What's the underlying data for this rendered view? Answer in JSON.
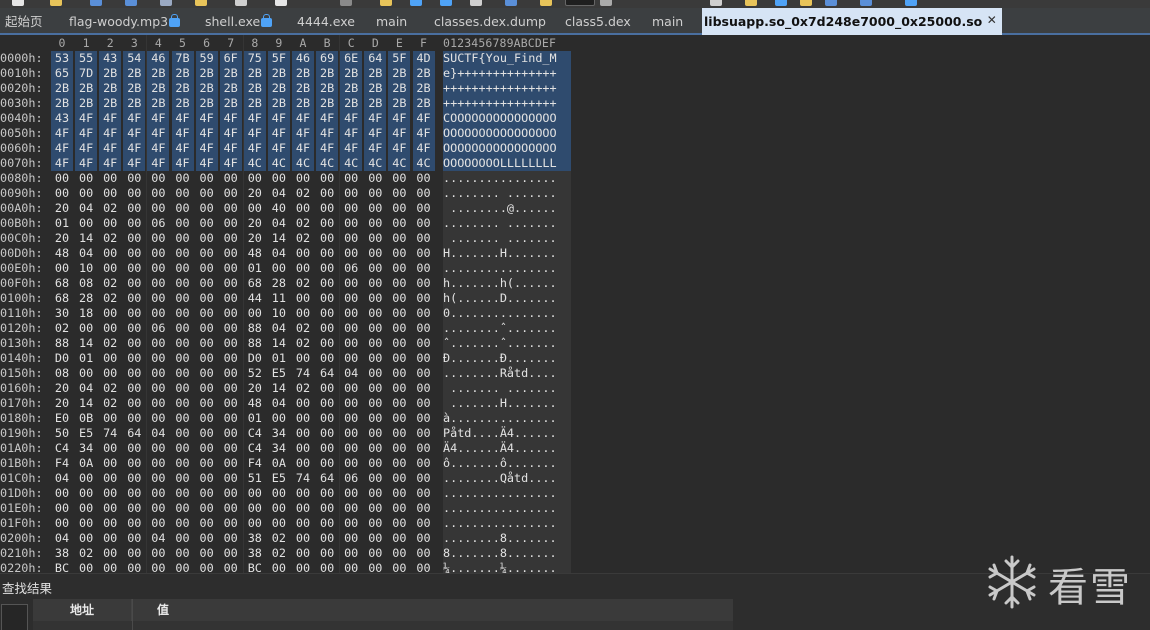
{
  "tabs": [
    {
      "label": "起始页",
      "locked": false,
      "active": false
    },
    {
      "label": "flag-woody.mp3",
      "locked": true,
      "active": false
    },
    {
      "label": "shell.exe",
      "locked": true,
      "active": false
    },
    {
      "label": "4444.exe",
      "locked": false,
      "active": false
    },
    {
      "label": "main",
      "locked": false,
      "active": false
    },
    {
      "label": "classes.dex.dump",
      "locked": false,
      "active": false
    },
    {
      "label": "class5.dex",
      "locked": false,
      "active": false
    },
    {
      "label": "main",
      "locked": false,
      "active": false
    },
    {
      "label": "libsuapp.so_0x7d248e7000_0x25000.so",
      "locked": false,
      "active": true
    }
  ],
  "hex_view": {
    "column_headers": [
      "0",
      "1",
      "2",
      "3",
      "4",
      "5",
      "6",
      "7",
      "8",
      "9",
      "A",
      "B",
      "C",
      "D",
      "E",
      "F"
    ],
    "ascii_header": "0123456789ABCDEF",
    "rows": [
      {
        "offset": "0000h:",
        "bytes": [
          "53",
          "55",
          "43",
          "54",
          "46",
          "7B",
          "59",
          "6F",
          "75",
          "5F",
          "46",
          "69",
          "6E",
          "64",
          "5F",
          "4D"
        ],
        "ascii": "SUCTF{You_Find_M",
        "selected": true
      },
      {
        "offset": "0010h:",
        "bytes": [
          "65",
          "7D",
          "2B",
          "2B",
          "2B",
          "2B",
          "2B",
          "2B",
          "2B",
          "2B",
          "2B",
          "2B",
          "2B",
          "2B",
          "2B",
          "2B"
        ],
        "ascii": "e}++++++++++++++",
        "selected": true
      },
      {
        "offset": "0020h:",
        "bytes": [
          "2B",
          "2B",
          "2B",
          "2B",
          "2B",
          "2B",
          "2B",
          "2B",
          "2B",
          "2B",
          "2B",
          "2B",
          "2B",
          "2B",
          "2B",
          "2B"
        ],
        "ascii": "++++++++++++++++",
        "selected": true
      },
      {
        "offset": "0030h:",
        "bytes": [
          "2B",
          "2B",
          "2B",
          "2B",
          "2B",
          "2B",
          "2B",
          "2B",
          "2B",
          "2B",
          "2B",
          "2B",
          "2B",
          "2B",
          "2B",
          "2B"
        ],
        "ascii": "++++++++++++++++",
        "selected": true
      },
      {
        "offset": "0040h:",
        "bytes": [
          "43",
          "4F",
          "4F",
          "4F",
          "4F",
          "4F",
          "4F",
          "4F",
          "4F",
          "4F",
          "4F",
          "4F",
          "4F",
          "4F",
          "4F",
          "4F"
        ],
        "ascii": "COOOOOOOOOOOOOOO",
        "selected": true
      },
      {
        "offset": "0050h:",
        "bytes": [
          "4F",
          "4F",
          "4F",
          "4F",
          "4F",
          "4F",
          "4F",
          "4F",
          "4F",
          "4F",
          "4F",
          "4F",
          "4F",
          "4F",
          "4F",
          "4F"
        ],
        "ascii": "OOOOOOOOOOOOOOOO",
        "selected": true
      },
      {
        "offset": "0060h:",
        "bytes": [
          "4F",
          "4F",
          "4F",
          "4F",
          "4F",
          "4F",
          "4F",
          "4F",
          "4F",
          "4F",
          "4F",
          "4F",
          "4F",
          "4F",
          "4F",
          "4F"
        ],
        "ascii": "OOOOOOOOOOOOOOOO",
        "selected": true
      },
      {
        "offset": "0070h:",
        "bytes": [
          "4F",
          "4F",
          "4F",
          "4F",
          "4F",
          "4F",
          "4F",
          "4F",
          "4C",
          "4C",
          "4C",
          "4C",
          "4C",
          "4C",
          "4C",
          "4C"
        ],
        "ascii": "OOOOOOOOLLLLLLLL",
        "selected": true
      },
      {
        "offset": "0080h:",
        "bytes": [
          "00",
          "00",
          "00",
          "00",
          "00",
          "00",
          "00",
          "00",
          "00",
          "00",
          "00",
          "00",
          "00",
          "00",
          "00",
          "00"
        ],
        "ascii": "................",
        "selected": false
      },
      {
        "offset": "0090h:",
        "bytes": [
          "00",
          "00",
          "00",
          "00",
          "00",
          "00",
          "00",
          "00",
          "20",
          "04",
          "02",
          "00",
          "00",
          "00",
          "00",
          "00"
        ],
        "ascii": "........ .......",
        "selected": false
      },
      {
        "offset": "00A0h:",
        "bytes": [
          "20",
          "04",
          "02",
          "00",
          "00",
          "00",
          "00",
          "00",
          "00",
          "40",
          "00",
          "00",
          "00",
          "00",
          "00",
          "00"
        ],
        "ascii": " ........@......",
        "selected": false
      },
      {
        "offset": "00B0h:",
        "bytes": [
          "01",
          "00",
          "00",
          "00",
          "06",
          "00",
          "00",
          "00",
          "20",
          "04",
          "02",
          "00",
          "00",
          "00",
          "00",
          "00"
        ],
        "ascii": "........ .......",
        "selected": false
      },
      {
        "offset": "00C0h:",
        "bytes": [
          "20",
          "14",
          "02",
          "00",
          "00",
          "00",
          "00",
          "00",
          "20",
          "14",
          "02",
          "00",
          "00",
          "00",
          "00",
          "00"
        ],
        "ascii": " ....... .......",
        "selected": false
      },
      {
        "offset": "00D0h:",
        "bytes": [
          "48",
          "04",
          "00",
          "00",
          "00",
          "00",
          "00",
          "00",
          "48",
          "04",
          "00",
          "00",
          "00",
          "00",
          "00",
          "00"
        ],
        "ascii": "H.......H.......",
        "selected": false
      },
      {
        "offset": "00E0h:",
        "bytes": [
          "00",
          "10",
          "00",
          "00",
          "00",
          "00",
          "00",
          "00",
          "01",
          "00",
          "00",
          "00",
          "06",
          "00",
          "00",
          "00"
        ],
        "ascii": "................",
        "selected": false
      },
      {
        "offset": "00F0h:",
        "bytes": [
          "68",
          "08",
          "02",
          "00",
          "00",
          "00",
          "00",
          "00",
          "68",
          "28",
          "02",
          "00",
          "00",
          "00",
          "00",
          "00"
        ],
        "ascii": "h.......h(......",
        "selected": false
      },
      {
        "offset": "0100h:",
        "bytes": [
          "68",
          "28",
          "02",
          "00",
          "00",
          "00",
          "00",
          "00",
          "44",
          "11",
          "00",
          "00",
          "00",
          "00",
          "00",
          "00"
        ],
        "ascii": "h(......D.......",
        "selected": false
      },
      {
        "offset": "0110h:",
        "bytes": [
          "30",
          "18",
          "00",
          "00",
          "00",
          "00",
          "00",
          "00",
          "00",
          "10",
          "00",
          "00",
          "00",
          "00",
          "00",
          "00"
        ],
        "ascii": "0...............",
        "selected": false
      },
      {
        "offset": "0120h:",
        "bytes": [
          "02",
          "00",
          "00",
          "00",
          "06",
          "00",
          "00",
          "00",
          "88",
          "04",
          "02",
          "00",
          "00",
          "00",
          "00",
          "00"
        ],
        "ascii": "........ˆ.......",
        "selected": false
      },
      {
        "offset": "0130h:",
        "bytes": [
          "88",
          "14",
          "02",
          "00",
          "00",
          "00",
          "00",
          "00",
          "88",
          "14",
          "02",
          "00",
          "00",
          "00",
          "00",
          "00"
        ],
        "ascii": "ˆ.......ˆ.......",
        "selected": false
      },
      {
        "offset": "0140h:",
        "bytes": [
          "D0",
          "01",
          "00",
          "00",
          "00",
          "00",
          "00",
          "00",
          "D0",
          "01",
          "00",
          "00",
          "00",
          "00",
          "00",
          "00"
        ],
        "ascii": "Ð.......Ð.......",
        "selected": false
      },
      {
        "offset": "0150h:",
        "bytes": [
          "08",
          "00",
          "00",
          "00",
          "00",
          "00",
          "00",
          "00",
          "52",
          "E5",
          "74",
          "64",
          "04",
          "00",
          "00",
          "00"
        ],
        "ascii": "........Råtd....",
        "selected": false
      },
      {
        "offset": "0160h:",
        "bytes": [
          "20",
          "04",
          "02",
          "00",
          "00",
          "00",
          "00",
          "00",
          "20",
          "14",
          "02",
          "00",
          "00",
          "00",
          "00",
          "00"
        ],
        "ascii": " ....... .......",
        "selected": false
      },
      {
        "offset": "0170h:",
        "bytes": [
          "20",
          "14",
          "02",
          "00",
          "00",
          "00",
          "00",
          "00",
          "48",
          "04",
          "00",
          "00",
          "00",
          "00",
          "00",
          "00"
        ],
        "ascii": " .......H.......",
        "selected": false
      },
      {
        "offset": "0180h:",
        "bytes": [
          "E0",
          "0B",
          "00",
          "00",
          "00",
          "00",
          "00",
          "00",
          "01",
          "00",
          "00",
          "00",
          "00",
          "00",
          "00",
          "00"
        ],
        "ascii": "à...............",
        "selected": false
      },
      {
        "offset": "0190h:",
        "bytes": [
          "50",
          "E5",
          "74",
          "64",
          "04",
          "00",
          "00",
          "00",
          "C4",
          "34",
          "00",
          "00",
          "00",
          "00",
          "00",
          "00"
        ],
        "ascii": "Påtd....Ä4......",
        "selected": false
      },
      {
        "offset": "01A0h:",
        "bytes": [
          "C4",
          "34",
          "00",
          "00",
          "00",
          "00",
          "00",
          "00",
          "C4",
          "34",
          "00",
          "00",
          "00",
          "00",
          "00",
          "00"
        ],
        "ascii": "Ä4......Ä4......",
        "selected": false
      },
      {
        "offset": "01B0h:",
        "bytes": [
          "F4",
          "0A",
          "00",
          "00",
          "00",
          "00",
          "00",
          "00",
          "F4",
          "0A",
          "00",
          "00",
          "00",
          "00",
          "00",
          "00"
        ],
        "ascii": "ô.......ô.......",
        "selected": false
      },
      {
        "offset": "01C0h:",
        "bytes": [
          "04",
          "00",
          "00",
          "00",
          "00",
          "00",
          "00",
          "00",
          "51",
          "E5",
          "74",
          "64",
          "06",
          "00",
          "00",
          "00"
        ],
        "ascii": "........Qåtd....",
        "selected": false
      },
      {
        "offset": "01D0h:",
        "bytes": [
          "00",
          "00",
          "00",
          "00",
          "00",
          "00",
          "00",
          "00",
          "00",
          "00",
          "00",
          "00",
          "00",
          "00",
          "00",
          "00"
        ],
        "ascii": "................",
        "selected": false
      },
      {
        "offset": "01E0h:",
        "bytes": [
          "00",
          "00",
          "00",
          "00",
          "00",
          "00",
          "00",
          "00",
          "00",
          "00",
          "00",
          "00",
          "00",
          "00",
          "00",
          "00"
        ],
        "ascii": "................",
        "selected": false
      },
      {
        "offset": "01F0h:",
        "bytes": [
          "00",
          "00",
          "00",
          "00",
          "00",
          "00",
          "00",
          "00",
          "00",
          "00",
          "00",
          "00",
          "00",
          "00",
          "00",
          "00"
        ],
        "ascii": "................",
        "selected": false
      },
      {
        "offset": "0200h:",
        "bytes": [
          "04",
          "00",
          "00",
          "00",
          "04",
          "00",
          "00",
          "00",
          "38",
          "02",
          "00",
          "00",
          "00",
          "00",
          "00",
          "00"
        ],
        "ascii": "........8.......",
        "selected": false
      },
      {
        "offset": "0210h:",
        "bytes": [
          "38",
          "02",
          "00",
          "00",
          "00",
          "00",
          "00",
          "00",
          "38",
          "02",
          "00",
          "00",
          "00",
          "00",
          "00",
          "00"
        ],
        "ascii": "8.......8.......",
        "selected": false
      },
      {
        "offset": "0220h:",
        "bytes": [
          "BC",
          "00",
          "00",
          "00",
          "00",
          "00",
          "00",
          "00",
          "BC",
          "00",
          "00",
          "00",
          "00",
          "00",
          "00",
          "00"
        ],
        "ascii": "¼.......¼.......",
        "selected": false
      }
    ]
  },
  "find_results": {
    "title": "查找结果",
    "columns": [
      "地址",
      "值"
    ]
  },
  "watermark": {
    "text": "看雪",
    "icon": "snowflake-icon"
  },
  "colors": {
    "selection": "#2f4b6e",
    "active_tab": "#d6e4f5",
    "background": "#2b2b2b",
    "lock": "#4fa3f7"
  }
}
